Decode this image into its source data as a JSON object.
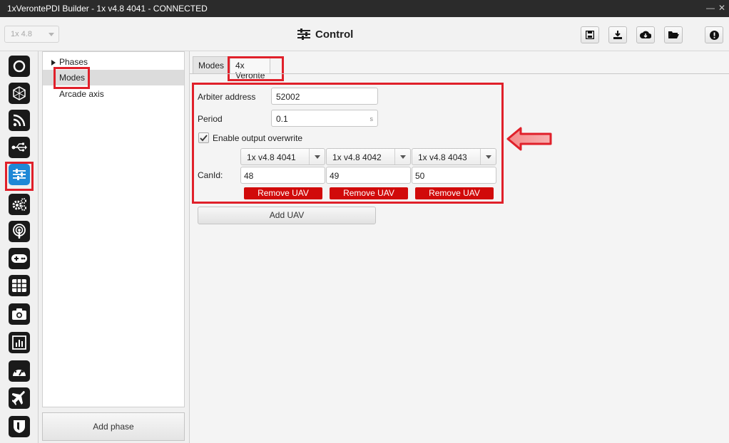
{
  "window": {
    "title": "1xVerontePDI Builder - 1x v4.8 4041 - CONNECTED",
    "minimize_glyph": "—",
    "close_glyph": "✕"
  },
  "toolbar": {
    "version_select": "1x 4.8",
    "page_title": "Control",
    "page_icon": "sliders-icon",
    "buttons": [
      "save-icon",
      "download-icon",
      "cloud-download-icon",
      "folder-open-icon",
      "alert-icon"
    ]
  },
  "sidebar": {
    "icons": [
      "power-icon",
      "hexagon-icon",
      "rss-icon",
      "usb-icon",
      "sliders-icon",
      "gears-icon",
      "podcast-icon",
      "gamepad-icon",
      "grid-icon",
      "camera-icon",
      "bar-chart-icon",
      "gauge-icon",
      "plane-icon",
      "shield-icon"
    ],
    "active_index": 4
  },
  "tree": {
    "items": [
      {
        "label": "Phases",
        "expandable": true
      },
      {
        "label": "Modes",
        "selected": true
      },
      {
        "label": "Arcade axis"
      }
    ],
    "add_phase_label": "Add phase"
  },
  "main": {
    "tabs": [
      {
        "label": "Modes",
        "active": false
      },
      {
        "label": "4x Veronte",
        "active": true
      }
    ],
    "arbiter_label": "Arbiter address",
    "arbiter_value": "52002",
    "period_label": "Period",
    "period_value": "0.1",
    "period_unit": "s",
    "overwrite_label": "Enable output overwrite",
    "overwrite_checked": true,
    "canid_label": "CanId:",
    "uavs": [
      {
        "device": "1x v4.8 4041",
        "canid": "48",
        "remove_label": "Remove UAV"
      },
      {
        "device": "1x v4.8 4042",
        "canid": "49",
        "remove_label": "Remove UAV"
      },
      {
        "device": "1x v4.8 4043",
        "canid": "50",
        "remove_label": "Remove UAV"
      }
    ],
    "add_uav_label": "Add UAV"
  },
  "colors": {
    "highlight_red": "#e0202a",
    "remove_button_red": "#d10a0a",
    "active_sidebar_blue": "#1e88d6",
    "titlebar_dark": "#2b2b2b"
  }
}
